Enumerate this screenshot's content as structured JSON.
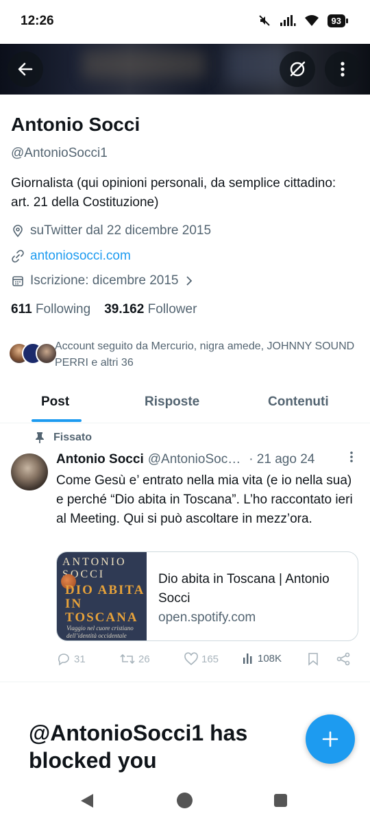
{
  "status_bar": {
    "time": "12:26",
    "battery": "93",
    "icons": [
      "mute-icon",
      "signal-icon",
      "wifi-icon",
      "battery-icon"
    ]
  },
  "header": {
    "back_icon": "arrow-left-icon",
    "grok_icon": "grok-icon",
    "more_icon": "more-vertical-icon"
  },
  "profile": {
    "name": "Antonio Socci",
    "handle": "@AntonioSocci1",
    "bio": "Giornalista (qui opinioni personali, da semplice cittadino: art. 21 della Costituzione)",
    "location": "suTwitter dal 22 dicembre 2015",
    "website": "antoniosocci.com",
    "joined": "Iscrizione: dicembre 2015",
    "following_count": "611",
    "following_label": "Following",
    "followers_count": "39.162",
    "followers_label": "Follower",
    "followed_by": "Account seguito da Mercurio, nigra amede, JOHNNY SOUND PERRI e altri 36"
  },
  "tabs": [
    {
      "label": "Post",
      "active": true
    },
    {
      "label": "Risposte",
      "active": false
    },
    {
      "label": "Contenuti",
      "active": false
    }
  ],
  "tweet": {
    "pinned_label": "Fissato",
    "author": "Antonio Socci",
    "handle": "@AntonioSoc…",
    "date": "· 21 ago 24",
    "text": "Come Gesù e’ entrato nella mia vita (e io nella sua) e perché “Dio abita in Toscana”. L’ho raccontato ieri al Meeting. Qui si può ascoltare in mezz’ora.",
    "card": {
      "cover_author": "ANTONIO SOCCI",
      "cover_title": "DIO ABITA IN TOSCANA",
      "cover_subtitle": "Viaggio nel cuore cristiano dell’identità occidentale",
      "title": "Dio abita in Toscana | Antonio Socci",
      "domain": "open.spotify.com"
    },
    "replies": "31",
    "retweets": "26",
    "likes": "165",
    "views": "108K"
  },
  "blocked": {
    "message": "@AntonioSocci1 has blocked you"
  },
  "colors": {
    "accent": "#1d9bf0",
    "text_primary": "#0f1419",
    "text_secondary": "#536471"
  }
}
